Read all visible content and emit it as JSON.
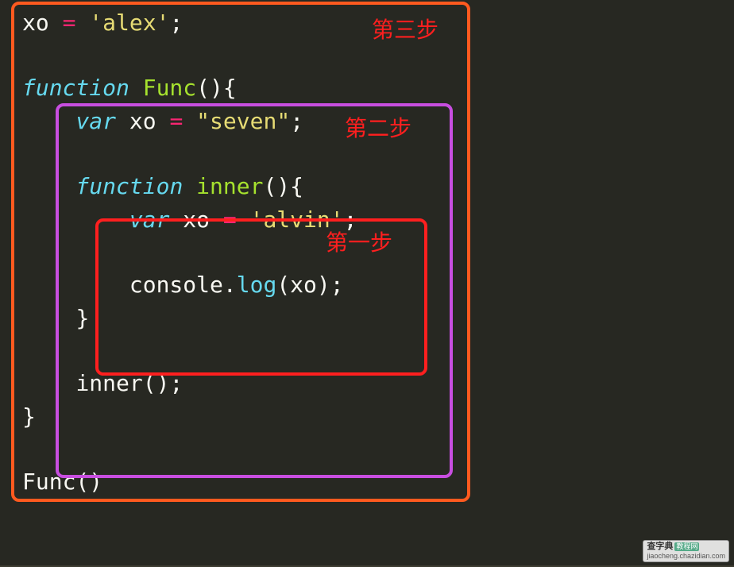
{
  "code": {
    "l1_ident": "xo ",
    "l1_op": "= ",
    "l1_str": "'alex'",
    "l1_punc": ";",
    "l3_kw": "function",
    "l3_sp": " ",
    "l3_fn": "Func",
    "l3_p1": "(){",
    "l4_indent": "    ",
    "l4_var": "var",
    "l4_sp": " ",
    "l4_ident": "xo ",
    "l4_op": "= ",
    "l4_str": "\"seven\"",
    "l4_punc": ";",
    "l6_indent": "    ",
    "l6_kw": "function",
    "l6_sp": " ",
    "l6_fn": "inner",
    "l6_p1": "(){",
    "l7_indent": "        ",
    "l7_var": "var",
    "l7_sp": " ",
    "l7_ident": "xo ",
    "l7_op": "= ",
    "l7_str": "'alvin'",
    "l7_punc": ";",
    "l9_indent": "        ",
    "l9_obj": "console",
    "l9_dot": ".",
    "l9_call": "log",
    "l9_p1": "(",
    "l9_arg": "xo",
    "l9_p2": ");",
    "l10_indent": "    ",
    "l10_brace": "}",
    "l12_indent": "    ",
    "l12_call": "inner();",
    "l13_brace": "}",
    "l15_call": "Func()"
  },
  "annotations": {
    "step1": "第一步",
    "step2": "第二步",
    "step3": "第三步"
  },
  "colors": {
    "box_outer": "#ff5a1f",
    "box_mid": "#c84ee0",
    "box_inner": "#ff1f1f",
    "label": "#ff1f1f"
  },
  "watermark": {
    "site": "查字典",
    "tut": "教程网",
    "url": "jiaocheng.chazidian.com"
  }
}
